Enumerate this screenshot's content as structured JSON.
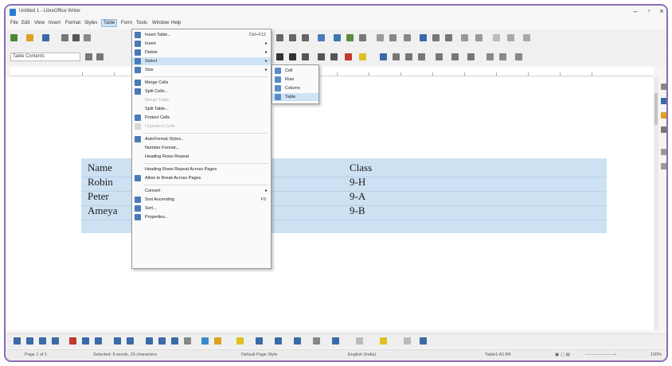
{
  "window": {
    "title": "Untitled 1 - LibreOffice Writer"
  },
  "menubar": [
    "File",
    "Edit",
    "View",
    "Insert",
    "Format",
    "Styles",
    "Table",
    "Form",
    "Tools",
    "Window",
    "Help"
  ],
  "toolbar": {
    "style_value": "Table Contents",
    "font_value": "Liberation Serif",
    "size_value": "12"
  },
  "table": {
    "rows": [
      [
        "Name",
        "Class"
      ],
      [
        "Robin",
        "9-H"
      ],
      [
        "Peter",
        "9-A"
      ],
      [
        "Ameya",
        "9-B"
      ]
    ]
  },
  "table_menu": {
    "items": [
      {
        "label": "Insert Table...",
        "shortcut": "Ctrl+F12",
        "icon": "insert-table-icon"
      },
      {
        "label": "Insert",
        "submenu": true,
        "icon": "insert-rows-icon"
      },
      {
        "label": "Delete",
        "submenu": true,
        "icon": "delete-rows-icon"
      },
      {
        "label": "Select",
        "submenu": true,
        "highlighted": true,
        "icon": "select-table-icon"
      },
      {
        "label": "Size",
        "submenu": true,
        "icon": "size-icon"
      },
      {
        "separator": true
      },
      {
        "label": "Merge Cells",
        "icon": "merge-cells-icon"
      },
      {
        "label": "Split Cells...",
        "icon": "split-cells-icon"
      },
      {
        "label": "Merge Table",
        "disabled": true
      },
      {
        "label": "Split Table..."
      },
      {
        "label": "Protect Cells",
        "icon": "protect-cells-icon"
      },
      {
        "label": "Unprotect Cells",
        "disabled": true,
        "icon": "unprotect-cells-icon"
      },
      {
        "separator": true
      },
      {
        "label": "AutoFormat Styles...",
        "icon": "autoformat-icon"
      },
      {
        "label": "Number Format..."
      },
      {
        "label": "Heading Rows Repeat"
      },
      {
        "separator": true
      },
      {
        "label": "Heading Rows Repeat Across Pages"
      },
      {
        "label": "Allow to Break Across Pages",
        "icon": "allow-break-icon"
      },
      {
        "separator": true
      },
      {
        "label": "Convert",
        "submenu": true
      },
      {
        "label": "Sort Ascending",
        "shortcut": "F9",
        "icon": "sort-icon"
      },
      {
        "label": "Sort...",
        "icon": "sort-dialog-icon"
      },
      {
        "label": "Properties...",
        "icon": "properties-icon"
      }
    ]
  },
  "select_submenu": {
    "items": [
      {
        "label": "Cell",
        "icon": "select-cell-icon"
      },
      {
        "label": "Row",
        "icon": "select-row-icon"
      },
      {
        "label": "Column",
        "icon": "select-column-icon"
      },
      {
        "label": "Table",
        "highlighted": true,
        "icon": "select-table-icon"
      }
    ]
  },
  "statusbar": {
    "page": "Page 1 of 1",
    "words": "Selected: 8 words, 33 characters",
    "page_style": "Default Page Style",
    "language": "English (India)",
    "table_name": "Table1:A1:B4",
    "zoom": "100%"
  },
  "colors": {
    "menu_highlight": "#cfe3f7",
    "table_fill": "#cde1f2",
    "frame_border": "#8e6bb5"
  }
}
